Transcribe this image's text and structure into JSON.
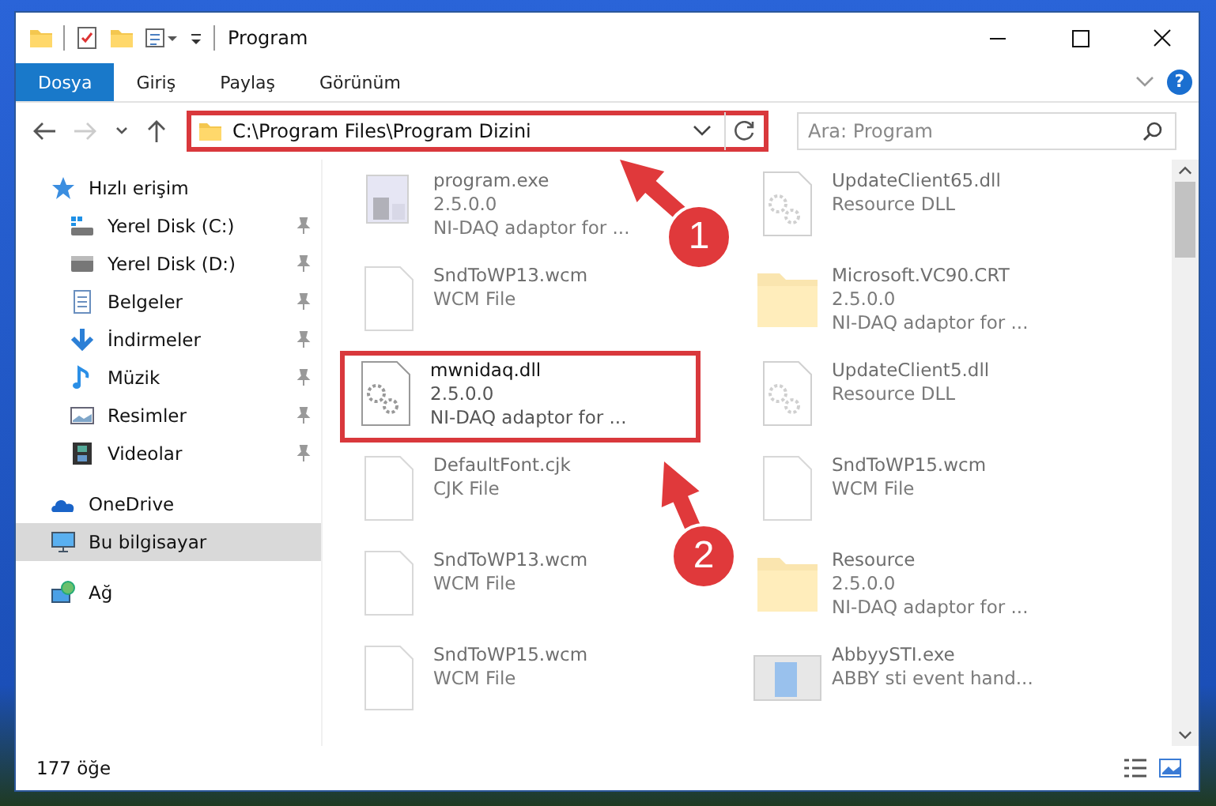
{
  "window": {
    "title": "Program"
  },
  "ribbon_tabs": [
    {
      "label": "Dosya",
      "selected": true
    },
    {
      "label": "Giriş",
      "selected": false
    },
    {
      "label": "Paylaş",
      "selected": false
    },
    {
      "label": "Görünüm",
      "selected": false
    }
  ],
  "help": "?",
  "address": {
    "path": "C:\\Program Files\\Program Dizini",
    "highlighted": true
  },
  "search": {
    "placeholder": "Ara: Program"
  },
  "sidebar": {
    "items": [
      {
        "label": "Hızlı erişim",
        "kind": "star",
        "selected": false,
        "children": [
          {
            "label": "Yerel Disk (C:)",
            "kind": "sysdrive",
            "pinned": true,
            "selected": false
          },
          {
            "label": "Yerel Disk (D:)",
            "kind": "drive",
            "pinned": true,
            "selected": false
          },
          {
            "label": "Belgeler",
            "kind": "docs",
            "pinned": true,
            "selected": false
          },
          {
            "label": "İndirmeler",
            "kind": "download",
            "pinned": true,
            "selected": false
          },
          {
            "label": "Müzik",
            "kind": "music",
            "pinned": true,
            "selected": false
          },
          {
            "label": "Resimler",
            "kind": "pictures",
            "pinned": true,
            "selected": false
          },
          {
            "label": "Videolar",
            "kind": "videos",
            "pinned": true,
            "selected": false
          }
        ]
      },
      {
        "label": "OneDrive",
        "kind": "cloud",
        "selected": false
      },
      {
        "label": "Bu bilgisayar",
        "kind": "pc",
        "selected": true
      },
      {
        "label": "Ağ",
        "kind": "network",
        "selected": false
      }
    ]
  },
  "files": [
    {
      "name": "program.exe",
      "lines": [
        "2.5.0.0",
        "NI-DAQ adaptor for ..."
      ],
      "kind": "app",
      "highlighted": false
    },
    {
      "name": "UpdateClient65.dll",
      "lines": [
        "Resource DLL"
      ],
      "kind": "dll",
      "highlighted": false
    },
    {
      "name": "SndToWP13.wcm",
      "lines": [
        "WCM File"
      ],
      "kind": "file",
      "highlighted": false
    },
    {
      "name": "Microsoft.VC90.CRT",
      "lines": [
        "2.5.0.0",
        "NI-DAQ adaptor for ..."
      ],
      "kind": "folder",
      "highlighted": false
    },
    {
      "name": "mwnidaq.dll",
      "lines": [
        "2.5.0.0",
        "NI-DAQ adaptor for ..."
      ],
      "kind": "dll",
      "highlighted": true
    },
    {
      "name": "UpdateClient5.dll",
      "lines": [
        "Resource DLL"
      ],
      "kind": "dll",
      "highlighted": false
    },
    {
      "name": "DefaultFont.cjk",
      "lines": [
        "CJK File"
      ],
      "kind": "file",
      "highlighted": false
    },
    {
      "name": "SndToWP15.wcm",
      "lines": [
        "WCM File"
      ],
      "kind": "file",
      "highlighted": false
    },
    {
      "name": "SndToWP13.wcm",
      "lines": [
        "WCM File"
      ],
      "kind": "file",
      "highlighted": false
    },
    {
      "name": "Resource",
      "lines": [
        "2.5.0.0",
        "NI-DAQ adaptor for ..."
      ],
      "kind": "folder",
      "highlighted": false
    },
    {
      "name": "SndToWP15.wcm",
      "lines": [
        "WCM File"
      ],
      "kind": "file",
      "highlighted": false
    },
    {
      "name": "AbbyySTI.exe",
      "lines": [
        "ABBY sti event hand..."
      ],
      "kind": "window",
      "highlighted": false
    }
  ],
  "status_bar": {
    "count": "177 öğe"
  },
  "annotations": [
    {
      "number": "1"
    },
    {
      "number": "2"
    }
  ]
}
